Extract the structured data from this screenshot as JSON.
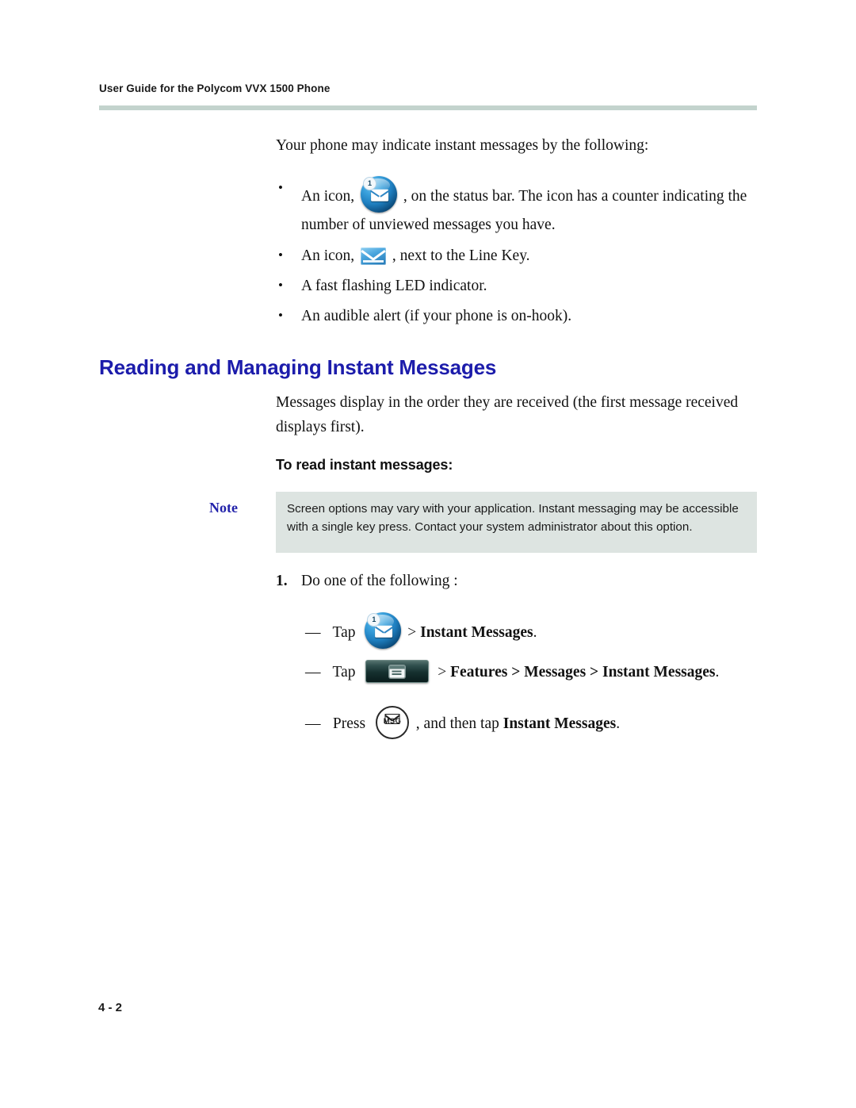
{
  "header": {
    "running_title": "User Guide for the Polycom VVX 1500 Phone",
    "rule_color": "#c3d3cd"
  },
  "intro": {
    "paragraph": "Your phone may indicate instant messages by the following:"
  },
  "bullets": [
    {
      "lead": "An icon,",
      "icon": "instant-message-sphere-icon",
      "badge": "1",
      "tail": ", on the status bar. The icon has a counter indicating the number of unviewed messages you have."
    },
    {
      "lead": "An icon,",
      "icon": "envelope-line-key-icon",
      "tail": ", next to the Line Key."
    },
    {
      "lead": "A fast flashing LED indicator.",
      "icon": null,
      "tail": ""
    },
    {
      "lead": "An audible alert (if your phone is on-hook).",
      "icon": null,
      "tail": ""
    }
  ],
  "section": {
    "heading": "Reading and Managing Instant Messages",
    "heading_color": "#1c1cab",
    "paragraph": "Messages display in the order they are received (the first message received displays first).",
    "sub_heading": "To read instant messages:"
  },
  "note": {
    "label": "Note",
    "label_color": "#2222aa",
    "background_color": "#dde4e1",
    "text": "Screen options may vary with your application. Instant messaging may be accessible with a single key press. Contact your system administrator about this option."
  },
  "step": {
    "number": "1.",
    "text": "Do one of the following :"
  },
  "substeps": [
    {
      "dash": "—",
      "lead": "Tap",
      "icon": "instant-message-sphere-icon",
      "badge": "1",
      "tail_plain": "> ",
      "tail_bold": "Instant Messages",
      "tail_end": "."
    },
    {
      "dash": "—",
      "lead": "Tap",
      "icon": "menu-softkey-icon",
      "tail_plain": "> ",
      "tail_bold": "Features > Messages > Instant Messages",
      "tail_end": "."
    },
    {
      "dash": "—",
      "lead": "Press",
      "icon": "msg-hard-key-icon",
      "icon_label": "MSG",
      "tail_plain": ", and then tap ",
      "tail_bold": "Instant Messages",
      "tail_end": "."
    }
  ],
  "footer": {
    "folio": "4 - 2"
  }
}
